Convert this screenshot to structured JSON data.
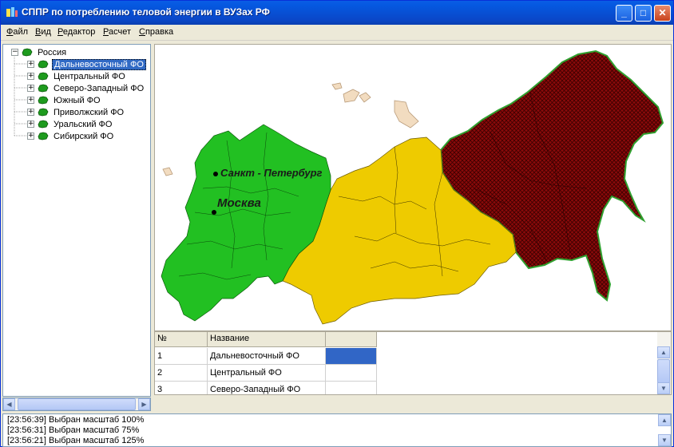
{
  "window": {
    "title": "СППР по потреблению теловой энергии в ВУЗах РФ",
    "app_icon": "app-logo-icon",
    "controls": {
      "minimize": "_",
      "maximize": "□",
      "close": "✕"
    }
  },
  "menu": {
    "items": [
      {
        "first": "Ф",
        "rest": "айл"
      },
      {
        "first": "В",
        "rest": "ид"
      },
      {
        "first": "Р",
        "rest": "едактор"
      },
      {
        "first": "Р",
        "rest": "асчет"
      },
      {
        "first": "С",
        "rest": "правка"
      }
    ]
  },
  "tree": {
    "root": {
      "label": "Россия",
      "expander": "−"
    },
    "items": [
      {
        "label": "Дальневосточный ФО",
        "expander": "+",
        "selected": true
      },
      {
        "label": "Центральный ФО",
        "expander": "+",
        "selected": false
      },
      {
        "label": "Северо-Западный ФО",
        "expander": "+",
        "selected": false
      },
      {
        "label": "Южный ФО",
        "expander": "+",
        "selected": false
      },
      {
        "label": "Приволжский ФО",
        "expander": "+",
        "selected": false
      },
      {
        "label": "Уральский ФО",
        "expander": "+",
        "selected": false
      },
      {
        "label": "Сибирский ФО",
        "expander": "+",
        "selected": false
      }
    ]
  },
  "map": {
    "labels": {
      "spb": "Санкт - Петербург",
      "moscow": "Москва"
    },
    "colors": {
      "central_west": "#22c022",
      "ural_siberia": "#eecb00",
      "far_east": "#8b0a0a",
      "islands": "#f2dcc0"
    }
  },
  "grid": {
    "headers": [
      "№",
      "Название",
      ""
    ],
    "rows": [
      {
        "num": "1",
        "name": "Дальневосточный ФО",
        "value_color": "#3166c6"
      },
      {
        "num": "2",
        "name": "Центральный ФО",
        "value_color": ""
      },
      {
        "num": "3",
        "name": "Северо-Западный ФО",
        "value_color": ""
      }
    ]
  },
  "log": {
    "lines": [
      "[23:56:39] Выбран масштаб 100%",
      "[23:56:31] Выбран масштаб 75%",
      "[23:56:21] Выбран масштаб 125%"
    ]
  }
}
